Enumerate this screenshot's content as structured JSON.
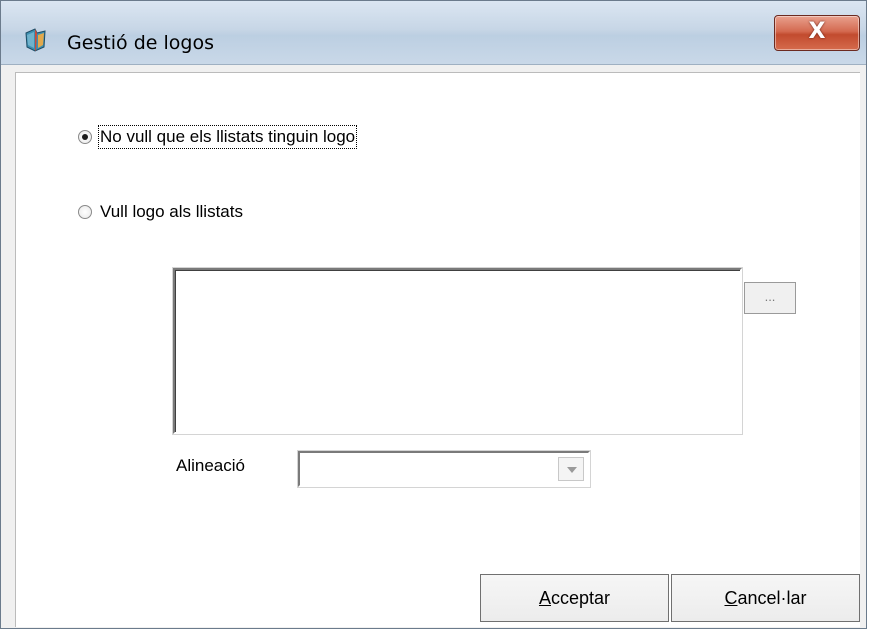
{
  "window": {
    "title": "Gestió de logos",
    "close_glyph": "X",
    "icon": "app-icon"
  },
  "options": {
    "no_logo": {
      "label": "No vull que els llistats tinguin logo",
      "checked": true
    },
    "with_logo": {
      "label": "Vull logo als llistats",
      "checked": false
    }
  },
  "logo": {
    "browse_label": "...",
    "alignment_label": "Alineació",
    "alignment_value": ""
  },
  "buttons": {
    "ok": {
      "mnemonic": "A",
      "rest": "cceptar"
    },
    "cancel": {
      "mnemonic": "C",
      "rest": "ancel·lar"
    }
  }
}
